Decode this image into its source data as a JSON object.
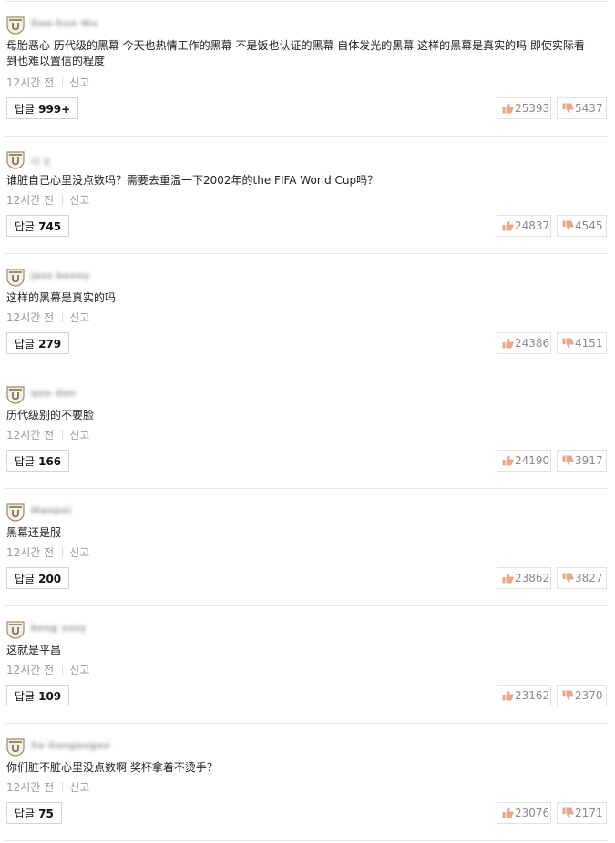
{
  "comments": [
    {
      "user": "Dae-hun Wu",
      "text": "母胎恶心 历代级的黑幕 今天也热情工作的黑幕 不是饭也认证的黑幕 自体发光的黑幕 这样的黑幕是真实的吗 即使实际看到也难以置信的程度",
      "time": "12시간 전",
      "report": "신고",
      "reply_label": "답글",
      "reply_count": "999+",
      "likes": "25393",
      "dislikes": "5437"
    },
    {
      "user": "나 2",
      "text": "谁脏自己心里没点数吗？需要去重温一下2002年的the FIFA World Cup吗？",
      "time": "12시간 전",
      "report": "신고",
      "reply_label": "답글",
      "reply_count": "745",
      "likes": "24837",
      "dislikes": "4545"
    },
    {
      "user": "jazz benny",
      "text": "这样的黑幕是真实的吗",
      "time": "12시간 전",
      "report": "신고",
      "reply_label": "답글",
      "reply_count": "279",
      "likes": "24386",
      "dislikes": "4151"
    },
    {
      "user": "quo dan",
      "text": "历代级别的不要脸",
      "time": "12시간 전",
      "report": "신고",
      "reply_label": "답글",
      "reply_count": "166",
      "likes": "24190",
      "dislikes": "3917"
    },
    {
      "user": "Manpoi",
      "text": "黑幕还是服",
      "time": "12시간 전",
      "report": "신고",
      "reply_label": "답글",
      "reply_count": "200",
      "likes": "23862",
      "dislikes": "3827"
    },
    {
      "user": "kong suzy",
      "text": "这就是平昌",
      "time": "12시간 전",
      "report": "신고",
      "reply_label": "답글",
      "reply_count": "109",
      "likes": "23162",
      "dislikes": "2370"
    },
    {
      "user": "Sa Gaogaogao",
      "text": "你们脏不脏心里没点数啊 奖杯拿着不烫手？",
      "time": "12시간 전",
      "report": "신고",
      "reply_label": "답글",
      "reply_count": "75",
      "likes": "23076",
      "dislikes": "2171"
    }
  ],
  "colors": {
    "accent_thumb": "#e9a787",
    "text_muted": "#9a9a9a",
    "border": "#d4d4d4"
  },
  "icons": {
    "avatar": "badge-avatar-icon",
    "like": "thumbs-up-icon",
    "dislike": "thumbs-down-icon"
  }
}
